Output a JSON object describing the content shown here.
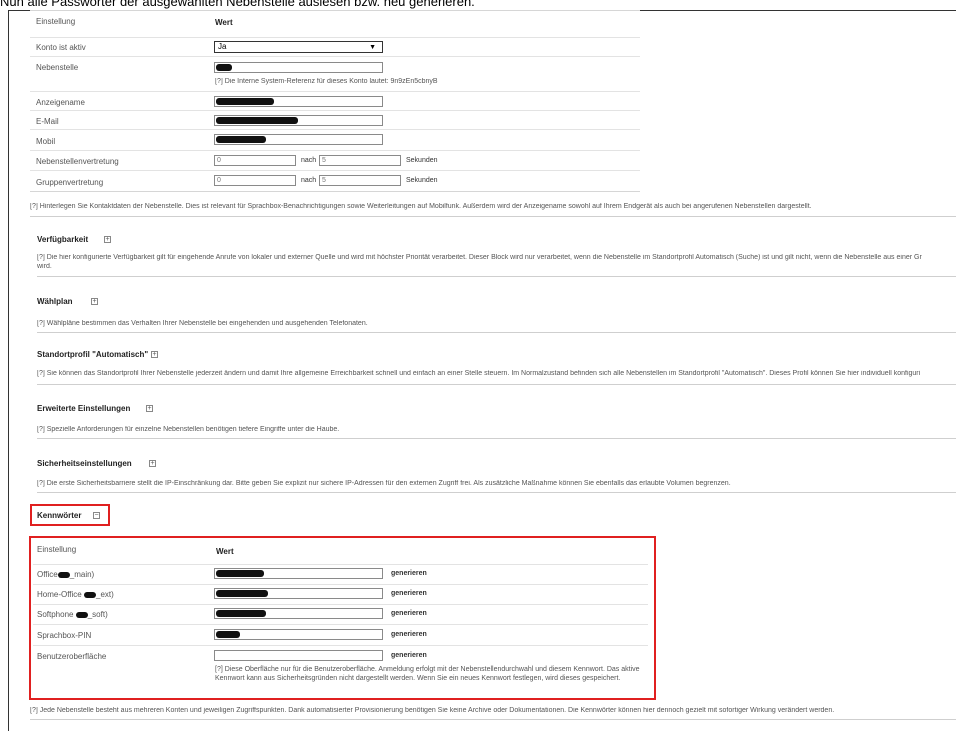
{
  "top_caption": "Nun alle Passwörter der ausgewählten Nebenstelle auslesen bzw. neu generieren.",
  "account_table": {
    "col_setting": "Einstellung",
    "col_value": "Wert",
    "rows": {
      "active_label": "Konto ist aktiv",
      "active_value": "Ja",
      "ext_label": "Nebenstelle",
      "ext_hint": "[?] Die Interne System-Referenz für dieses Konto lautet: 9n9zEn5cbnyB",
      "display_label": "Anzeigename",
      "email_label": "E-Mail",
      "mobile_label": "Mobil",
      "ext_rep_label": "Nebenstellenvertretung",
      "ext_rep_from": "0",
      "ext_rep_after": "nach",
      "ext_rep_to": "5",
      "ext_rep_unit": "Sekunden",
      "group_rep_label": "Gruppenvertretung",
      "group_rep_from": "0",
      "group_rep_after": "nach",
      "group_rep_to": "5",
      "group_rep_unit": "Sekunden"
    },
    "hint": "[?] Hinterlegen Sie Kontaktdaten der Nebenstelle. Dies ist relevant für Sprachbox-Benachrichtigungen sowie Weiterleitungen auf Mobilfunk. Außerdem wird der Anzeigename sowohl auf Ihrem Endgerät als auch bei angerufenen Nebenstellen dargestellt."
  },
  "sections": [
    {
      "title": "Verfügbarkeit",
      "hint": "[?] Die hier konfigurierte Verfügbarkeit gilt für eingehende Anrufe von lokaler und externer Quelle und wird mit höchster Priorität verarbeitet. Dieser Block wird nur verarbeitet, wenn die Nebenstelle im Standortprofil Automatisch (Suche) ist und gilt nicht, wenn die Nebenstelle aus einer Gr",
      "hint2": "wird."
    },
    {
      "title": "Wählplan",
      "hint": "[?] Wählpläne bestimmen das Verhalten Ihrer Nebenstelle bei eingehenden und ausgehenden Telefonaten."
    },
    {
      "title": "Standortprofil \"Automatisch\"",
      "hint": "[?] Sie können das Standortprofil Ihrer Nebenstelle jederzeit ändern und damit Ihre allgemeine Erreichbarkeit schnell und einfach an einer Stelle steuern. Im Normalzustand befinden sich alle Nebenstellen im Standortprofil \"Automatisch\". Dieses Profil können Sie hier individuell konfiguri"
    },
    {
      "title": "Erweiterte Einstellungen",
      "hint": "[?] Spezielle Anforderungen für einzelne Nebenstellen benötigen tiefere Eingriffe unter die Haube."
    },
    {
      "title": "Sicherheitseinstellungen",
      "hint": "[?] Die erste Sicherheitsbarriere stellt die IP-Einschränkung dar. Bitte geben Sie explizit nur sichere IP-Adressen für den externen Zugriff frei. Als zusätzliche Maßnahme können Sie ebenfalls das erlaubte Volumen begrenzen."
    }
  ],
  "passwords": {
    "title": "Kennwörter",
    "toggle": "−",
    "col_setting": "Einstellung",
    "col_value": "Wert",
    "generate_label": "generieren",
    "rows": [
      {
        "label_prefix": "Office",
        "label_suffix": "_main)"
      },
      {
        "label_prefix": "Home-Office",
        "label_suffix": "_ext)"
      },
      {
        "label_prefix": "Softphone",
        "label_suffix": "_soft)"
      },
      {
        "label_prefix": "Sprachbox-PIN",
        "label_suffix": ""
      },
      {
        "label_prefix": "Benutzeroberfläche",
        "label_suffix": ""
      }
    ],
    "ui_hint": "[?] Diese Oberfläche nur für die Benutzeroberfläche. Anmeldung erfolgt mit der Nebenstellendurchwahl und diesem Kennwort. Das aktive Kennwort kann aus Sicherheitsgründen nicht dargestellt werden. Wenn Sie ein neues Kennwort festlegen, wird dieses gespeichert.",
    "footer_hint": "[?] Jede Nebenstelle besteht aus mehreren Konten und jeweiligen Zugriffspunkten. Dank automatisierter Provisionierung benötigen Sie keine Archive oder Dokumentationen. Die Kennwörter können hier dennoch gezielt mit sofortiger Wirkung verändert werden."
  }
}
